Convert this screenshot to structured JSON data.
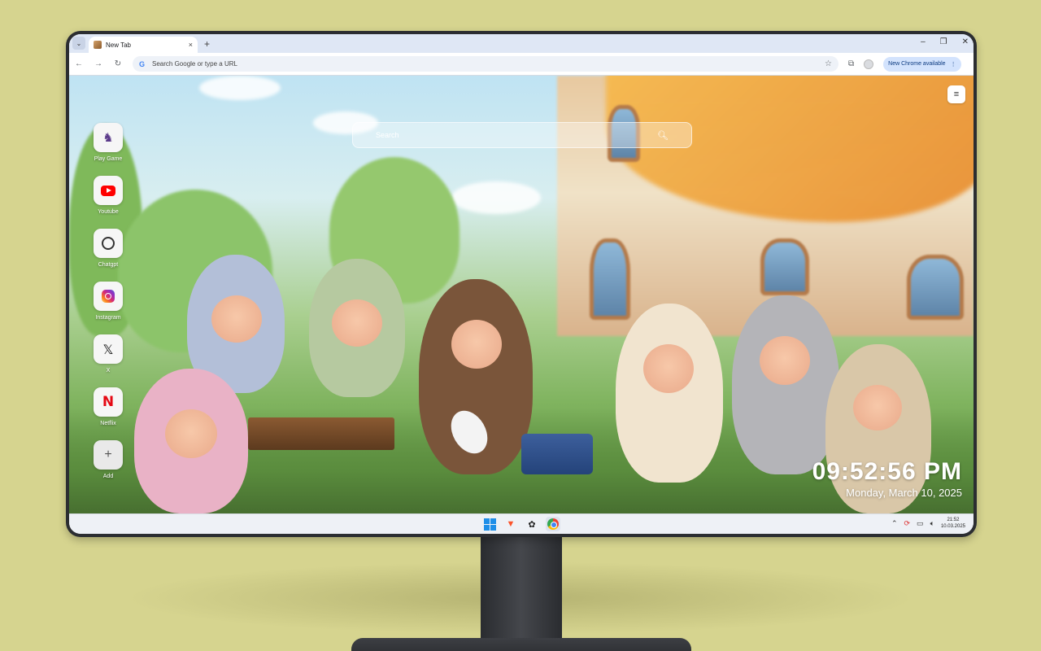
{
  "browser": {
    "tab_title": "New Tab",
    "tab_close": "×",
    "new_tab": "+",
    "omnibox_placeholder": "Search Google or type a URL",
    "update_label": "New Chrome available",
    "window_controls": [
      "–",
      "❐",
      "✕"
    ]
  },
  "newtab": {
    "search_placeholder": "Search",
    "shortcuts": [
      {
        "label": "Play Game",
        "icon": "game-icon"
      },
      {
        "label": "Youtube",
        "icon": "youtube-icon"
      },
      {
        "label": "Chatgpt",
        "icon": "chatgpt-icon"
      },
      {
        "label": "Instagram",
        "icon": "instagram-icon"
      },
      {
        "label": "X",
        "icon": "x-icon"
      },
      {
        "label": "Netflix",
        "icon": "netflix-icon"
      },
      {
        "label": "Add",
        "icon": "add-icon"
      }
    ],
    "clock_time": "09:52:56 PM",
    "clock_date": "Monday, March 10, 2025"
  },
  "taskbar": {
    "time": "21:52",
    "date": "10.03.2025",
    "apps": [
      "windows-start-icon",
      "brave-icon",
      "app-icon",
      "chrome-icon"
    ]
  },
  "colors": {
    "background": "#d6d48f",
    "monitor": "#2b2d31",
    "update_chip": "#d3e3fd"
  }
}
